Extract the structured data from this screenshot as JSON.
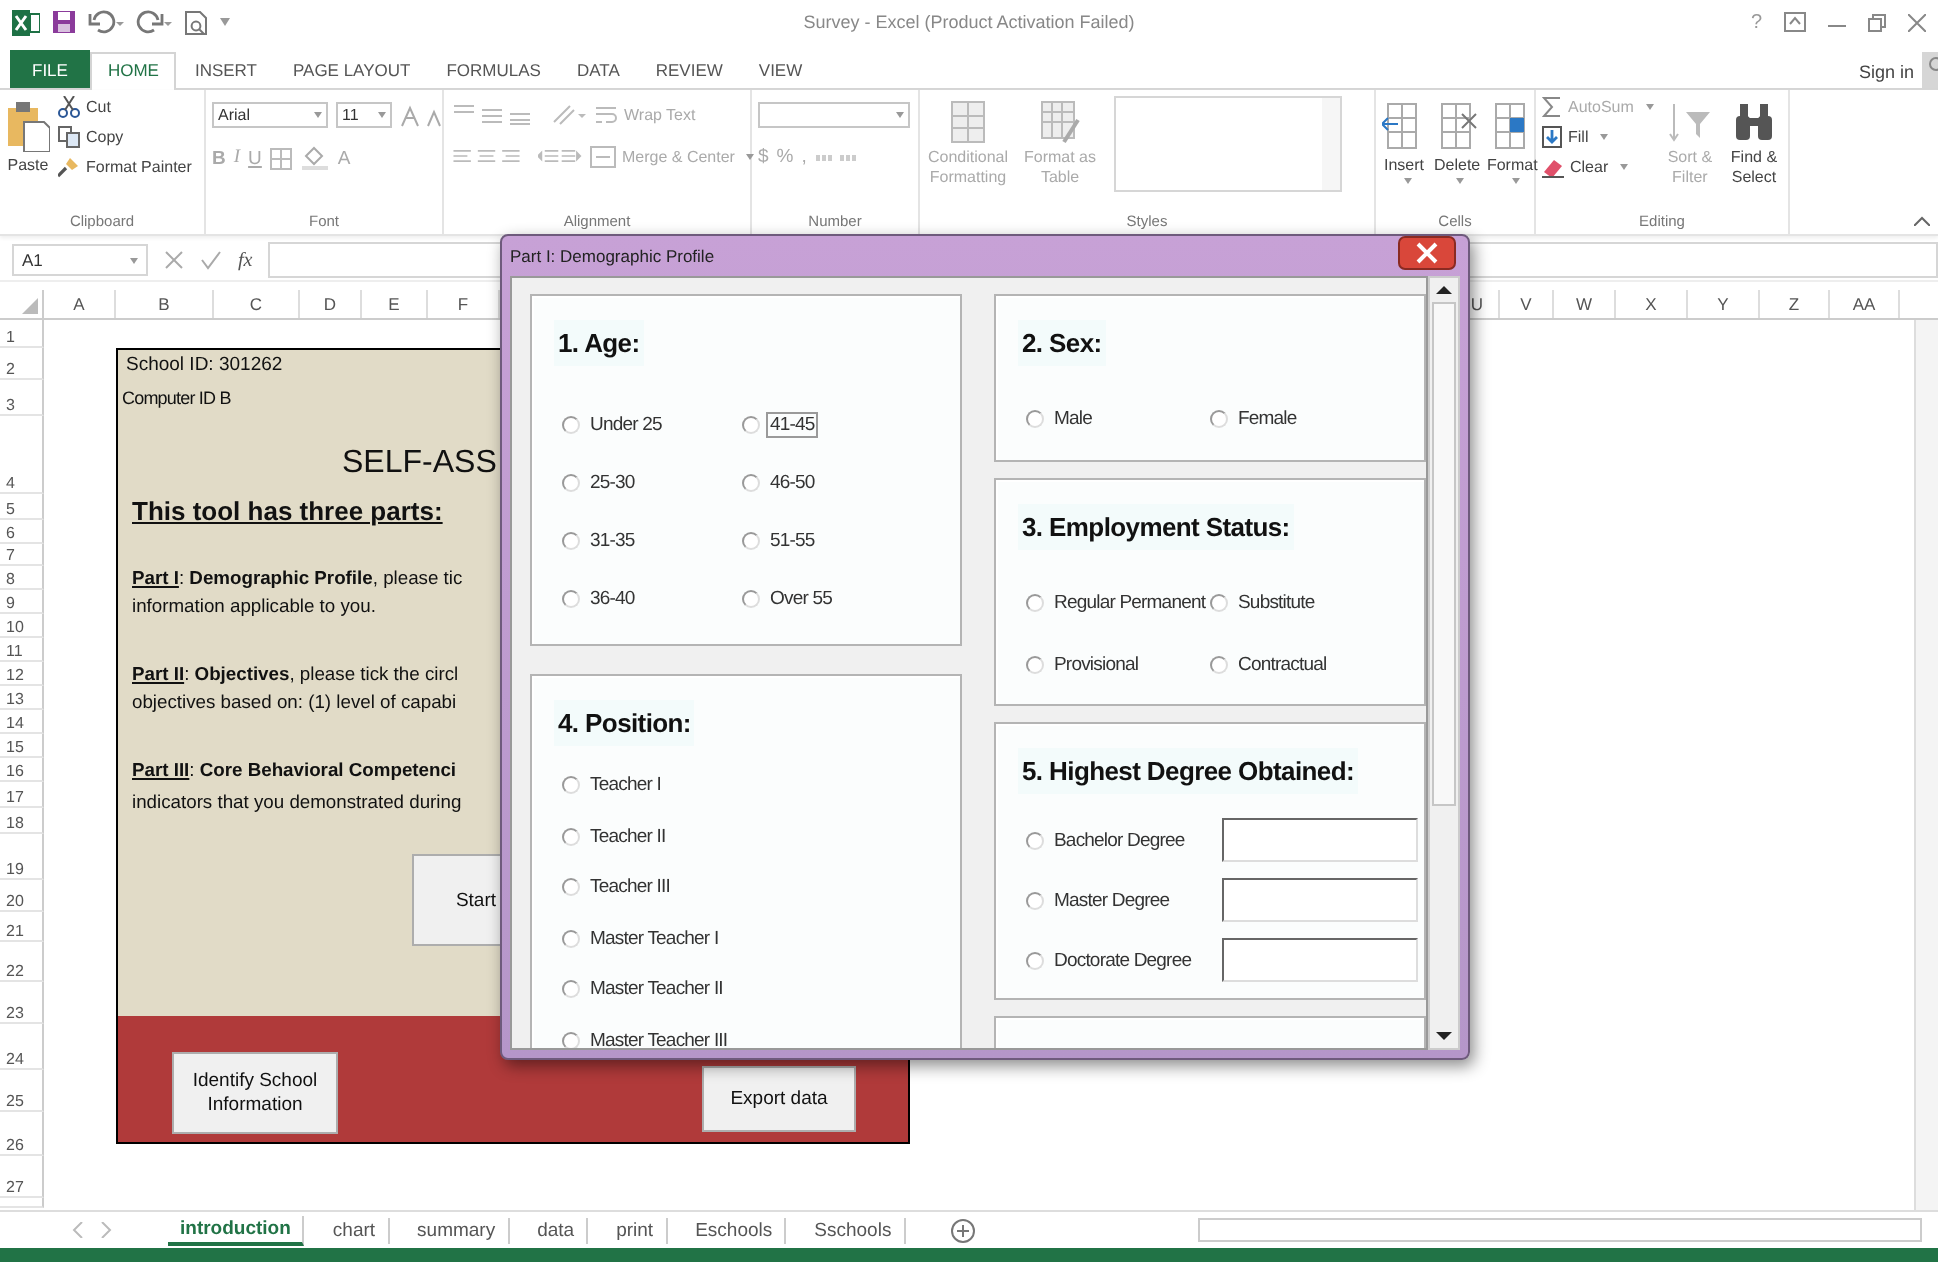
{
  "window": {
    "title": "Survey - Excel (Product Activation Failed)",
    "help": "?"
  },
  "ribbon_tabs": [
    {
      "label": "FILE",
      "kind": "file",
      "selected": false
    },
    {
      "label": "HOME",
      "kind": "tab",
      "selected": true
    },
    {
      "label": "INSERT",
      "kind": "tab",
      "selected": false
    },
    {
      "label": "PAGE LAYOUT",
      "kind": "tab",
      "selected": false
    },
    {
      "label": "FORMULAS",
      "kind": "tab",
      "selected": false
    },
    {
      "label": "DATA",
      "kind": "tab",
      "selected": false
    },
    {
      "label": "REVIEW",
      "kind": "tab",
      "selected": false
    },
    {
      "label": "VIEW",
      "kind": "tab",
      "selected": false
    }
  ],
  "sign_in": "Sign in",
  "ribbon_groups": [
    {
      "kind": "clipboard",
      "label": "Clipboard",
      "items": [
        {
          "label": "Paste",
          "disabled": false
        },
        {
          "label": "Cut",
          "disabled": false
        },
        {
          "label": "Copy",
          "disabled": false
        },
        {
          "label": "Format Painter",
          "disabled": false
        }
      ]
    },
    {
      "kind": "font",
      "label": "Font",
      "items": [
        {
          "label": "Arial",
          "disabled": false
        },
        {
          "label": "11",
          "disabled": false
        },
        {
          "label": "B",
          "disabled": true
        },
        {
          "label": "I",
          "disabled": true
        },
        {
          "label": "U",
          "disabled": true
        },
        {
          "label": "A",
          "disabled": true
        }
      ]
    },
    {
      "kind": "alignment",
      "label": "Alignment",
      "items": [
        {
          "label": "Wrap Text",
          "disabled": true
        },
        {
          "label": "Merge & Center",
          "disabled": true
        }
      ]
    },
    {
      "kind": "number",
      "label": "Number",
      "items": [
        {
          "label": "$",
          "disabled": true
        },
        {
          "label": "%",
          "disabled": true
        },
        {
          "label": ",",
          "disabled": true
        }
      ]
    },
    {
      "kind": "styles",
      "label": "Styles",
      "items": [
        {
          "label": "Conditional Formatting",
          "disabled": true
        },
        {
          "label": "Format as Table",
          "disabled": true
        }
      ]
    },
    {
      "kind": "cells",
      "label": "Cells",
      "items": [
        {
          "label": "Insert",
          "disabled": false
        },
        {
          "label": "Delete",
          "disabled": false
        },
        {
          "label": "Format",
          "disabled": false
        }
      ]
    },
    {
      "kind": "editing",
      "label": "Editing",
      "items": [
        {
          "label": "AutoSum",
          "disabled": true
        },
        {
          "label": "Fill",
          "disabled": false
        },
        {
          "label": "Clear",
          "disabled": false
        },
        {
          "label": "Sort & Filter",
          "disabled": true
        },
        {
          "label": "Find & Select",
          "disabled": false
        }
      ]
    }
  ],
  "formula_bar": {
    "name_box": "A1",
    "function_label": "fx"
  },
  "columns": [
    "A",
    "B",
    "C",
    "D",
    "E",
    "F",
    "U",
    "V",
    "W",
    "X",
    "Y",
    "Z",
    "AA"
  ],
  "rows": [
    "1",
    "2",
    "3",
    "4",
    "5",
    "6",
    "7",
    "8",
    "9",
    "10",
    "11",
    "12",
    "13",
    "14",
    "15",
    "16",
    "17",
    "18",
    "19",
    "20",
    "21",
    "22",
    "23",
    "24",
    "25",
    "26",
    "27"
  ],
  "sheet_card": {
    "school_id": "School ID:  301262",
    "computer_id": "Computer ID B",
    "title": "SELF-ASS",
    "intro": "This tool has three parts:",
    "lines": [
      "**Part I**: **Demographic Profile**, please tic",
      "information applicable to you.",
      "**Part II**: **Objectives**, please tick the circl",
      "objectives based on: (1) level of capabi",
      "**Part III**: **Core Behavioral Competenci**",
      "indicators that you demonstrated during"
    ],
    "buttons": [
      "Start",
      "Identify School Information",
      "Export data"
    ]
  },
  "dialog": {
    "title": "Part I: Demographic Profile",
    "age": {
      "heading": "1. Age:",
      "options": [
        {
          "label": "Under 25",
          "selected": false,
          "focused": false
        },
        {
          "label": "41-45",
          "selected": false,
          "focused": true
        },
        {
          "label": "25-30",
          "selected": false,
          "focused": false
        },
        {
          "label": "46-50",
          "selected": false,
          "focused": false
        },
        {
          "label": "31-35",
          "selected": false,
          "focused": false
        },
        {
          "label": "51-55",
          "selected": false,
          "focused": false
        },
        {
          "label": "36-40",
          "selected": false,
          "focused": false
        },
        {
          "label": "Over 55",
          "selected": false,
          "focused": false
        }
      ]
    },
    "position": {
      "heading": "4. Position:",
      "options": [
        {
          "label": "Teacher I",
          "selected": false
        },
        {
          "label": "Teacher II",
          "selected": false
        },
        {
          "label": "Teacher III",
          "selected": false
        },
        {
          "label": "Master Teacher I",
          "selected": false
        },
        {
          "label": "Master Teacher II",
          "selected": false
        },
        {
          "label": "Master Teacher III",
          "selected": false
        }
      ]
    },
    "sex": {
      "heading": "2. Sex:",
      "options": [
        {
          "label": "Male",
          "selected": false
        },
        {
          "label": "Female",
          "selected": false
        }
      ]
    },
    "employment": {
      "heading": "3. Employment Status:",
      "options": [
        {
          "label": "Regular Permanent",
          "selected": false
        },
        {
          "label": "Substitute",
          "selected": false
        },
        {
          "label": "Provisional",
          "selected": false
        },
        {
          "label": "Contractual",
          "selected": false
        }
      ]
    },
    "degree": {
      "heading": "5. Highest Degree Obtained:",
      "options": [
        {
          "label": "Bachelor Degree",
          "selected": false
        },
        {
          "label": "Master Degree",
          "selected": false
        },
        {
          "label": "Doctorate Degree",
          "selected": false
        }
      ]
    }
  },
  "sheet_tabs": [
    {
      "label": "introduction",
      "selected": true
    },
    {
      "label": "chart",
      "selected": false
    },
    {
      "label": "summary",
      "selected": false
    },
    {
      "label": "data",
      "selected": false
    },
    {
      "label": "print",
      "selected": false
    },
    {
      "label": "Eschools",
      "selected": false
    },
    {
      "label": "Sschools",
      "selected": false
    }
  ]
}
